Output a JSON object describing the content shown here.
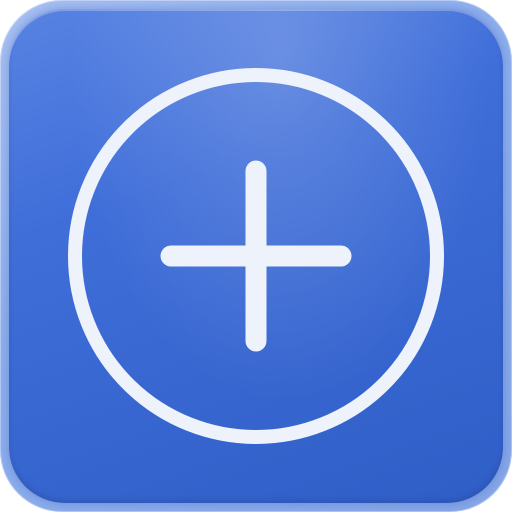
{
  "app_icon": {
    "icon": "plus-circle-icon",
    "colors": {
      "background_top": "#5883e3",
      "background_bottom": "#2f5ec7",
      "frame": "#8fb0ee",
      "glyph": "#eef2fb"
    }
  }
}
